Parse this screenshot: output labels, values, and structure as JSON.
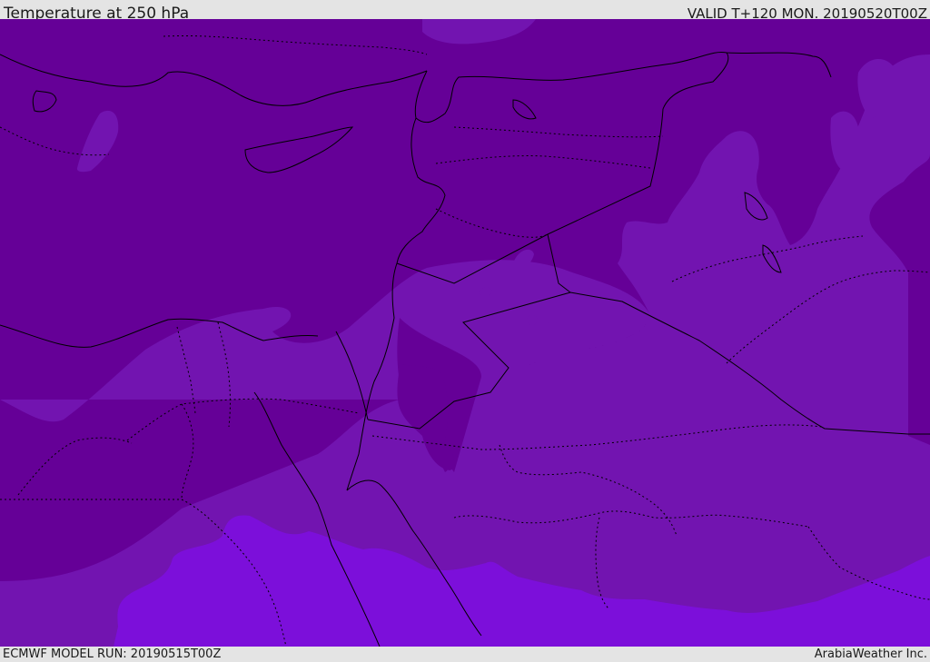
{
  "header": {
    "title": "Temperature at 250 hPa",
    "valid": "VALID T+120 MON. 20190520T00Z"
  },
  "footer": {
    "model_run": "ECMWF MODEL RUN: 20190515T00Z",
    "credit": "ArabiaWeather Inc."
  },
  "map": {
    "variable": "temperature",
    "level": "250 hPa",
    "colors": {
      "coldest_band": "#650097",
      "cold_band": "#7214b0",
      "mid_band": "#7c0fda",
      "boundary_line": "#000000"
    }
  }
}
